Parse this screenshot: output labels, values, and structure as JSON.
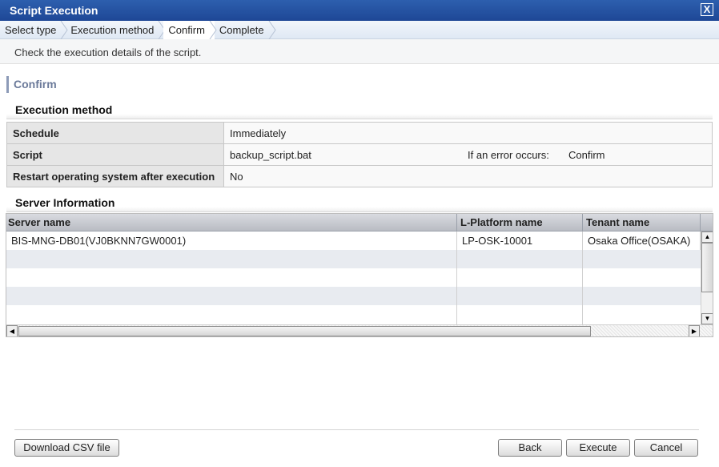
{
  "window": {
    "title": "Script Execution",
    "close_label": "X"
  },
  "steps": [
    {
      "label": "Select type"
    },
    {
      "label": "Execution method"
    },
    {
      "label": "Confirm"
    },
    {
      "label": "Complete"
    }
  ],
  "instruction": "Check the execution details of the script.",
  "section_heading": "Confirm",
  "execution_method": {
    "title": "Execution method",
    "rows": [
      {
        "label": "Schedule",
        "value": "Immediately"
      },
      {
        "label": "Script",
        "value": "backup_script.bat",
        "extra_label": "If an error occurs:",
        "extra_value": "Confirm"
      },
      {
        "label": "Restart operating system after execution",
        "value": "No"
      }
    ]
  },
  "server_information": {
    "title": "Server Information",
    "columns": [
      "Server name",
      "L-Platform name",
      "Tenant name"
    ],
    "rows": [
      [
        "BIS-MNG-DB01(VJ0BKNN7GW0001)",
        "LP-OSK-10001",
        "Osaka Office(OSAKA)"
      ]
    ]
  },
  "buttons": {
    "download_csv": "Download CSV file",
    "back": "Back",
    "execute": "Execute",
    "cancel": "Cancel"
  },
  "colors": {
    "titlebar": "#1e4796",
    "steps_bar": "#dfe8f4",
    "label_cell": "#e6e6e6",
    "grid_header": "#b9bcc3"
  }
}
